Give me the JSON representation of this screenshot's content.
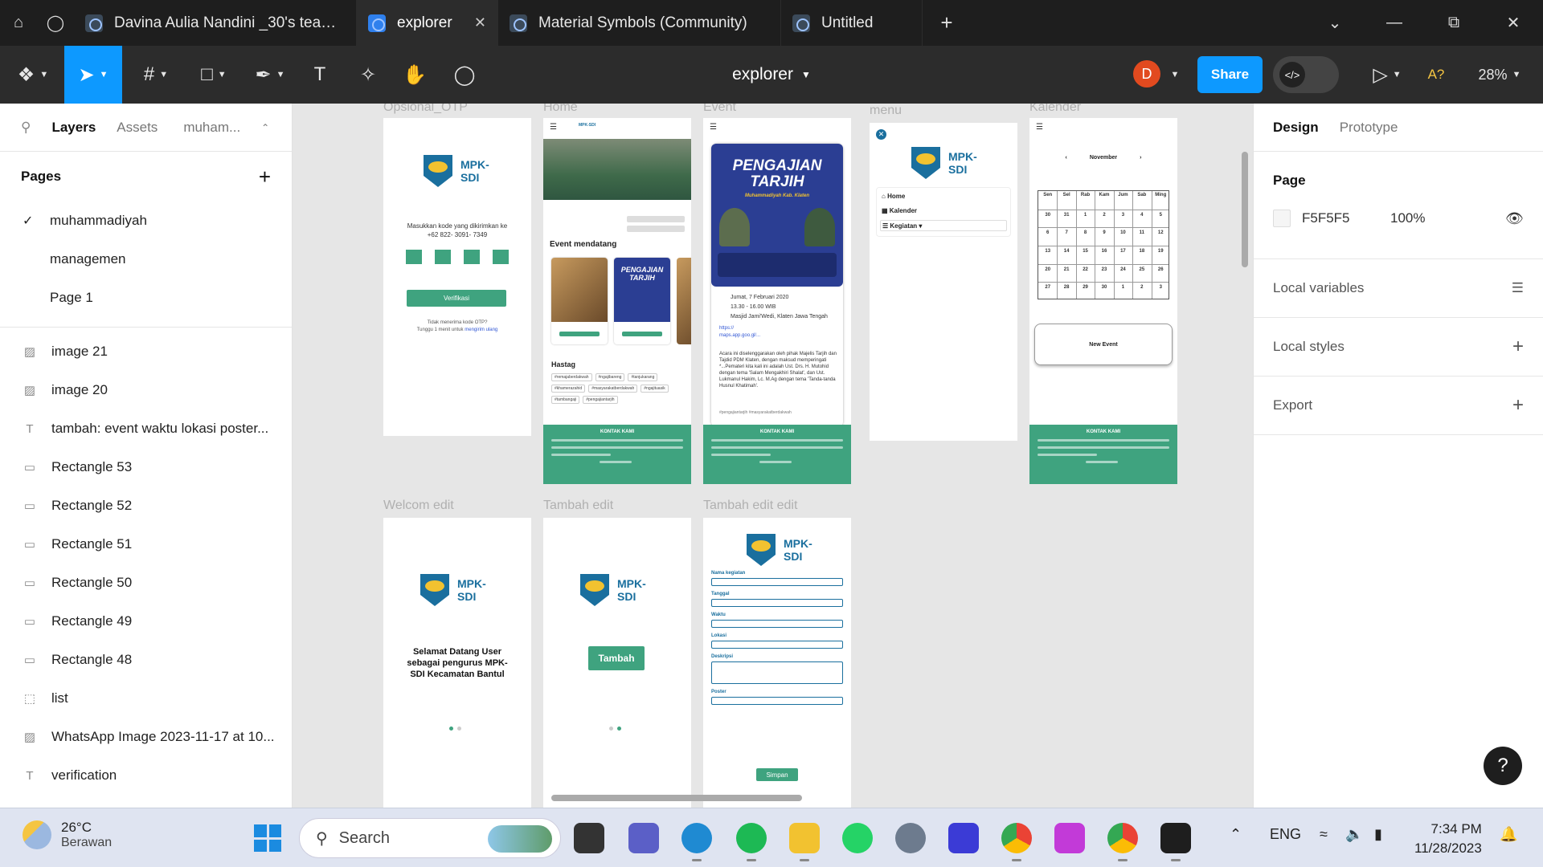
{
  "tabs": [
    {
      "label": "Davina Aulia Nandini _30's team library",
      "active": false
    },
    {
      "label": "explorer",
      "active": true
    },
    {
      "label": "Material Symbols (Community)",
      "active": false
    },
    {
      "label": "Untitled",
      "active": false
    }
  ],
  "toolbar": {
    "file_name": "explorer",
    "avatar_initial": "D",
    "share_label": "Share",
    "a_label": "A?",
    "zoom": "28%"
  },
  "left_panel": {
    "tabs": [
      "Layers",
      "Assets",
      "muham..."
    ],
    "pages_title": "Pages",
    "pages": [
      {
        "name": "muhammadiyah",
        "current": true
      },
      {
        "name": "managemen",
        "current": false
      },
      {
        "name": "Page 1",
        "current": false
      }
    ],
    "layers": [
      {
        "name": "image 21",
        "icon": "image-icon"
      },
      {
        "name": "image 20",
        "icon": "image-icon"
      },
      {
        "name": "tambah: event waktu lokasi poster...",
        "icon": "text-icon"
      },
      {
        "name": "Rectangle 53",
        "icon": "rectangle-icon"
      },
      {
        "name": "Rectangle 52",
        "icon": "rectangle-icon"
      },
      {
        "name": "Rectangle 51",
        "icon": "rectangle-icon"
      },
      {
        "name": "Rectangle 50",
        "icon": "rectangle-icon"
      },
      {
        "name": "Rectangle 49",
        "icon": "rectangle-icon"
      },
      {
        "name": "Rectangle 48",
        "icon": "rectangle-icon"
      },
      {
        "name": "list",
        "icon": "frame-icon"
      },
      {
        "name": "WhatsApp Image 2023-11-17 at 10...",
        "icon": "image-icon"
      },
      {
        "name": "verification",
        "icon": "text-icon"
      }
    ]
  },
  "canvas": {
    "frames": {
      "otp": {
        "label": "Opsional_OTP",
        "logo": "MPK-\nSDI",
        "prompt": "Masukkan kode yang dikirimkan ke",
        "phone": "+62 822- 3091- 7349",
        "button": "Verifikasi",
        "note1": "Tidak menerima kode OTP?",
        "note2": "Tunggu 1 menit untuk",
        "note_link": "mengirim ulang"
      },
      "home": {
        "label": "Home",
        "brand": "MPK-SDI",
        "section1": "Event mendatang",
        "section2": "Hastag",
        "tags": [
          "#remajaberdakwah",
          "#ngajibareng",
          "#tanjukarang",
          "#khamerazahid",
          "#masyarakatberdakwah",
          "#ngajituasik",
          "#tambangaji",
          "#pengajiantarjih"
        ],
        "footer_title": "KONTAK KAMI"
      },
      "event": {
        "label": "Event",
        "poster_title": "PENGAJIAN TARJIH",
        "poster_sub": "Muhammadiyah Kab. Klaten",
        "date": "Jumat, 7 Februari 2020",
        "time": "13.30 - 16.00 WIB",
        "place": "Masjid Jami'Wedi, Klaten Jawa Tengah",
        "description": "Acara ini diselenggarakan oleh pihak Majelis Tarjih dan Tajdid PDM Klaten, dengan maksud memperingati *...Pemateri kita kali ini adalah Ust. Drs. H. Mutohid dengan tema 'Salam Mengakhiri Shalat', dan Ust. Lukmanul Hakim, Lc. M.Ag dengan tema 'Tanda-tanda Husnul Khatimah'.",
        "tags": "#pengajiantarjih #masyarakatberdakwah",
        "footer_title": "KONTAK KAMI"
      },
      "menu": {
        "label": "menu",
        "logo": "MPK-\nSDI",
        "items": [
          "Home",
          "Kalender",
          "Kegiatan"
        ]
      },
      "kalender": {
        "label": "Kalender",
        "month": "November",
        "days": [
          "Sen",
          "Sel",
          "Rab",
          "Kam",
          "Jum",
          "Sab",
          "Ming"
        ],
        "weeks": [
          [
            "30",
            "31",
            "1",
            "2",
            "3",
            "4",
            "5"
          ],
          [
            "6",
            "7",
            "8",
            "9",
            "10",
            "11",
            "12"
          ],
          [
            "13",
            "14",
            "15",
            "16",
            "17",
            "18",
            "19"
          ],
          [
            "20",
            "21",
            "22",
            "23",
            "24",
            "25",
            "26"
          ],
          [
            "27",
            "28",
            "29",
            "30",
            "1",
            "2",
            "3"
          ]
        ],
        "new_event": "New Event",
        "footer_title": "KONTAK KAMI"
      },
      "welcome": {
        "label": "Welcom edit",
        "logo": "MPK-\nSDI",
        "greeting": "Selamat Datang User sebagai pengurus MPK-SDI Kecamatan Bantul"
      },
      "tambah": {
        "label": "Tambah edit",
        "logo": "MPK-\nSDI",
        "button": "Tambah"
      },
      "tambah_form": {
        "label": "Tambah edit edit",
        "logo": "MPK-\nSDI",
        "fields": [
          "Nama kegiatan",
          "Tanggal",
          "Waktu",
          "Lokasi",
          "Deskripsi",
          "Poster"
        ],
        "button": "Simpan"
      }
    }
  },
  "right_panel": {
    "tabs": [
      "Design",
      "Prototype"
    ],
    "page_title": "Page",
    "page_color": "F5F5F5",
    "page_opacity": "100%",
    "sections": [
      "Local variables",
      "Local styles",
      "Export"
    ]
  },
  "taskbar": {
    "temp": "26°C",
    "weather": "Berawan",
    "search": "Search",
    "lang": "ENG",
    "time": "7:34 PM",
    "date": "11/28/2023"
  },
  "colors": {
    "accent": "#0d99ff",
    "brand_green": "#3fa37f",
    "poster_blue": "#2b3e93",
    "avatar": "#e24a1f"
  }
}
